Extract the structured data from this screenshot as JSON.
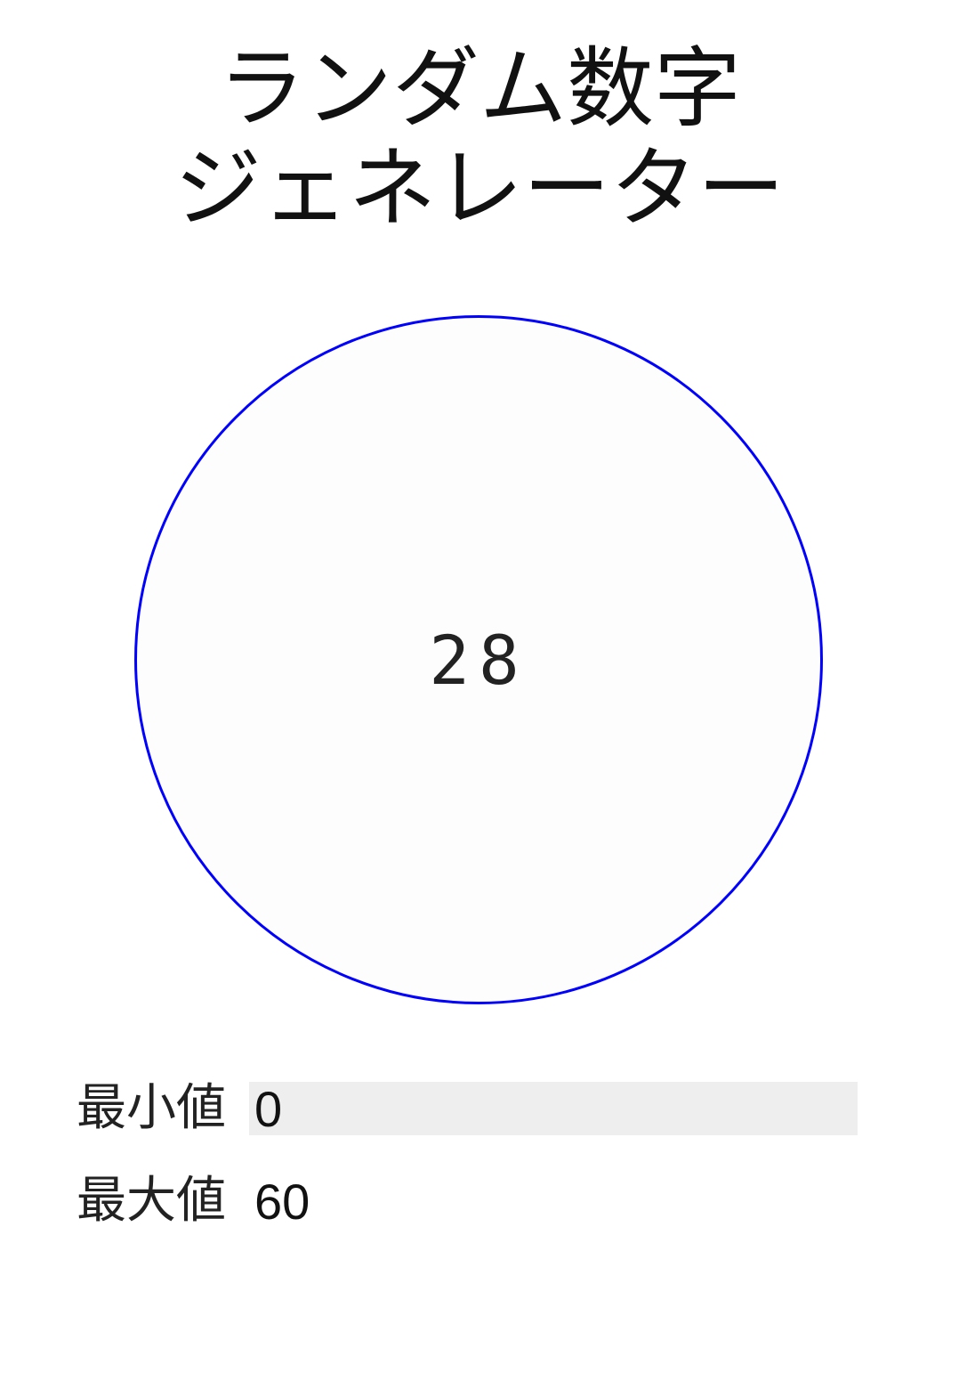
{
  "title": {
    "line1": "ランダム数字",
    "line2": "ジェネレーター"
  },
  "generator": {
    "result": "28",
    "circle_color": "#0000ff"
  },
  "inputs": {
    "min_label": "最小値",
    "min_value": "0",
    "max_label": "最大値",
    "max_value": "60"
  }
}
